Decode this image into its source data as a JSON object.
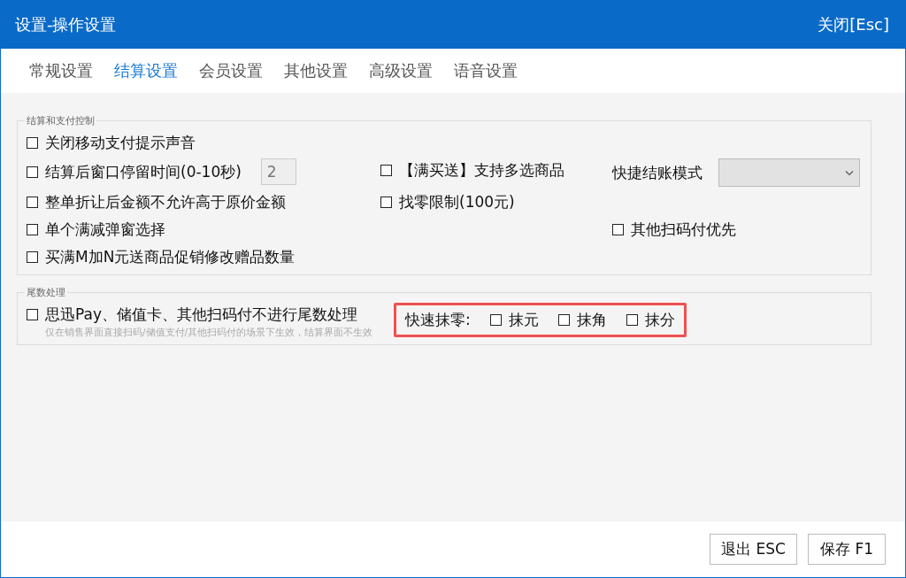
{
  "window": {
    "title": "设置-操作设置",
    "close_label": "关闭[Esc]"
  },
  "tabs": [
    {
      "label": "常规设置",
      "selected": false
    },
    {
      "label": "结算设置",
      "selected": true
    },
    {
      "label": "会员设置",
      "selected": false
    },
    {
      "label": "其他设置",
      "selected": false
    },
    {
      "label": "高级设置",
      "selected": false
    },
    {
      "label": "语音设置",
      "selected": false
    }
  ],
  "payment_group": {
    "title": "结算和支付控制",
    "rows": [
      {
        "left": {
          "label": "关闭移动支付提示声音",
          "checked": false
        }
      },
      {
        "left": {
          "label": "结算后窗口停留时间(0-10秒)",
          "checked": false,
          "value": "2"
        },
        "middle": {
          "label": "【满买送】支持多选商品",
          "checked": false
        },
        "right": {
          "kind": "select",
          "label": "快捷结账模式"
        }
      },
      {
        "left": {
          "label": "整单折让后金额不允许高于原价金额",
          "checked": false
        },
        "middle": {
          "label": "找零限制(100元)",
          "checked": false
        }
      },
      {
        "left": {
          "label": "单个满减弹窗选择",
          "checked": false
        },
        "right": {
          "kind": "checkbox",
          "label": "其他扫码付优先",
          "checked": false
        }
      },
      {
        "left": {
          "label": "买满M加N元送商品促销修改赠品数量",
          "checked": false
        }
      }
    ]
  },
  "rounding_group": {
    "title": "尾数处理",
    "option": {
      "label": "思迅Pay、储值卡、其他扫码付不进行尾数处理",
      "checked": false,
      "hint": "仅在销售界面直接扫码/储值支付/其他扫码付的场景下生效，结算界面不生效"
    },
    "quick_label": "快速抹零:",
    "quick_options": [
      {
        "label": "抹元",
        "checked": false
      },
      {
        "label": "抹角",
        "checked": false
      },
      {
        "label": "抹分",
        "checked": false
      }
    ]
  },
  "buttons": [
    "退出 ESC",
    "保存 F1"
  ]
}
